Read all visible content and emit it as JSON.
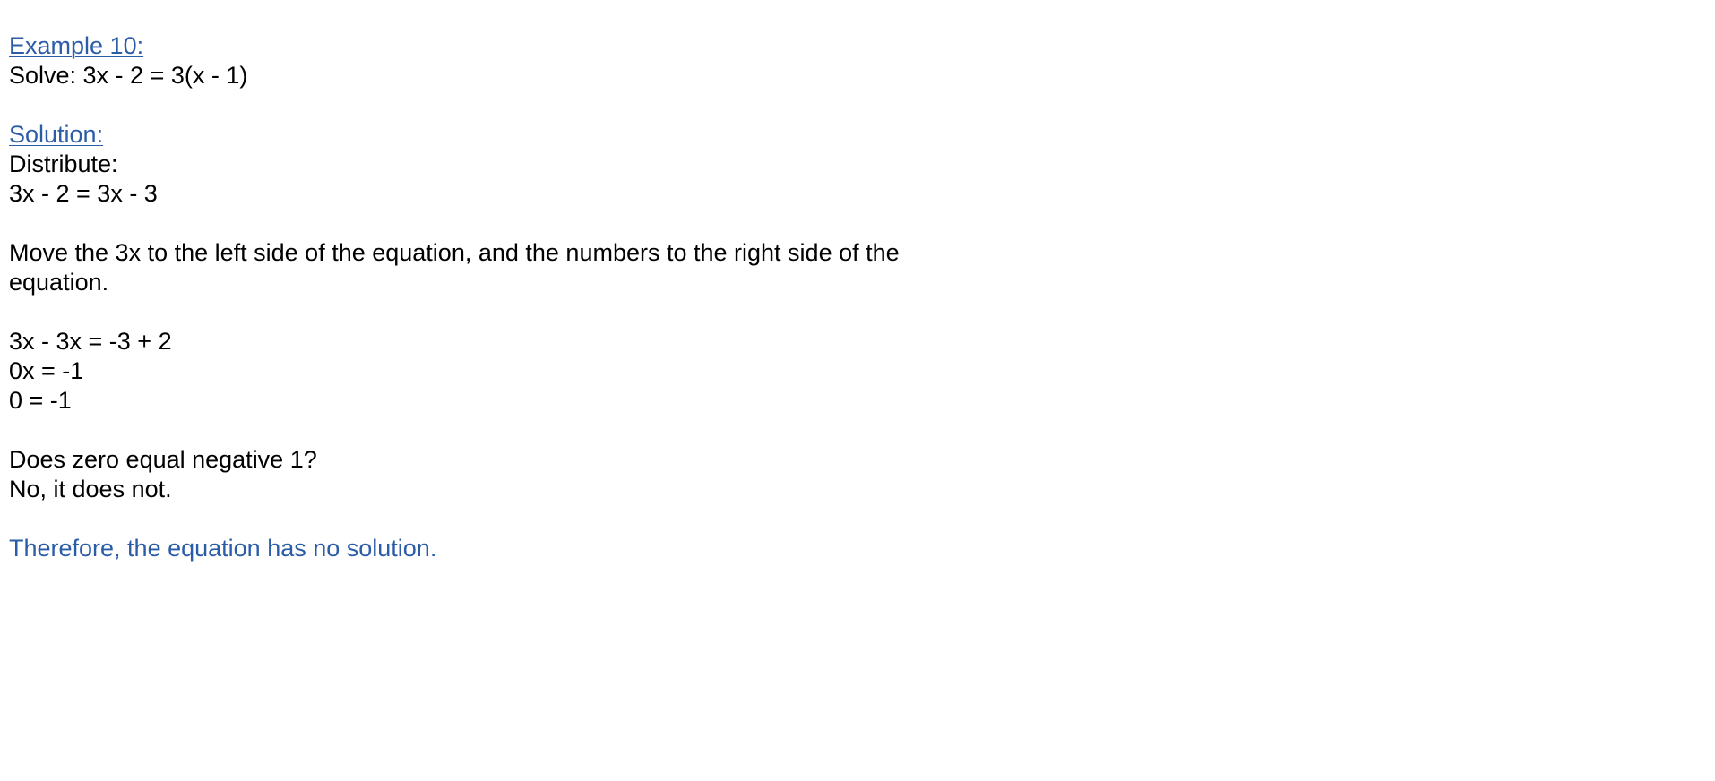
{
  "example_heading": "Example 10:",
  "problem": "Solve:  3x - 2 = 3(x - 1)",
  "solution_heading": "Solution:",
  "steps": {
    "distribute_label": "Distribute:",
    "distributed": "3x - 2 = 3x - 3",
    "instruction": "Move the 3x to the left side of the equation, and the numbers to the right side of the equation.",
    "step1": "3x - 3x = -3 + 2",
    "step2": "0x = -1",
    "step3": "0 = -1",
    "question": "Does zero equal negative 1?",
    "answer": "No, it does not.",
    "conclusion": "Therefore, the equation has no solution."
  },
  "colors": {
    "accent": "#2b5ca8",
    "text": "#000000"
  }
}
